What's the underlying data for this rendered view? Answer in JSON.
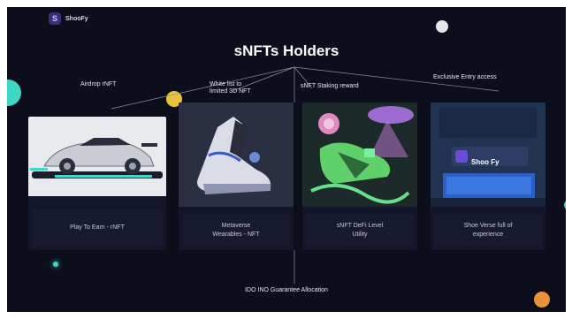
{
  "brand": {
    "logo_letter": "S",
    "name": "ShooFy"
  },
  "title": "sNFTs Holders",
  "labels": {
    "airdrop": "Airdrop  rNFT",
    "whitelist_line1": "White list to",
    "whitelist_line2": "limited 3D NFT",
    "staking": "sNFT Staking reward",
    "exclusive": "Exclusive Entry access"
  },
  "cards": [
    {
      "caption": "Play To Earn - rNFT",
      "icon": "sports-car-image"
    },
    {
      "caption": "Metaverse\nWearables - NFT",
      "icon": "sneaker-image"
    },
    {
      "caption": "sNFT DeFi Level\nUtility",
      "icon": "neon-shoe-art-image"
    },
    {
      "caption": "Shoe Verse full of\nexperience",
      "icon": "shoe-store-image"
    }
  ],
  "bottom_label": "IDO INO Guarantee Allocation",
  "store_sign": "Shoo Fy",
  "colors": {
    "background": "#0c0e1c",
    "accent_teal": "#3fd6c6",
    "accent_yellow": "#e9c13a",
    "accent_orange": "#e8923a",
    "accent_purple": "#6c4bd8"
  }
}
